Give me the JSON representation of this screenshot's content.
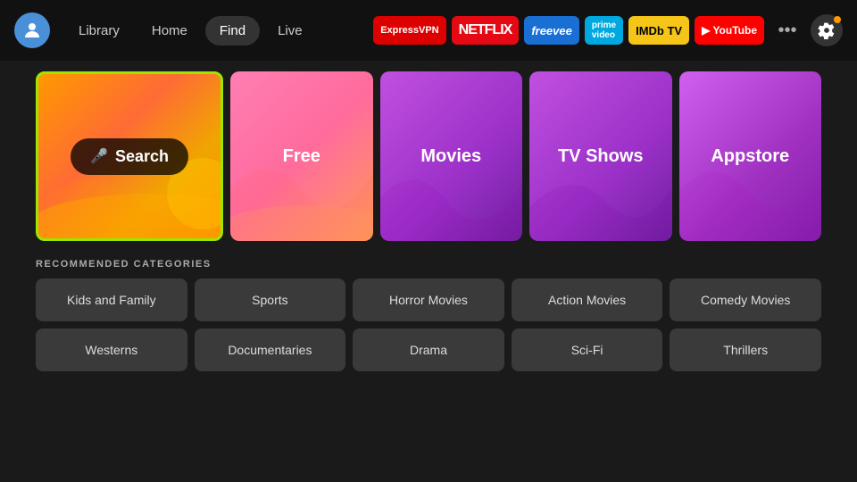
{
  "nav": {
    "links": [
      {
        "label": "Library",
        "active": false
      },
      {
        "label": "Home",
        "active": false
      },
      {
        "label": "Find",
        "active": true
      },
      {
        "label": "Live",
        "active": false
      }
    ]
  },
  "apps": [
    {
      "label": "ExpressVPN",
      "class": "badge-expressvpn"
    },
    {
      "label": "NETFLIX",
      "class": "badge-netflix"
    },
    {
      "label": "freevee",
      "class": "badge-freevee"
    },
    {
      "label": "prime video",
      "class": "badge-prime"
    },
    {
      "label": "IMDb TV",
      "class": "badge-imdb"
    },
    {
      "label": "▶ YouTube",
      "class": "badge-youtube"
    }
  ],
  "hero_tiles": [
    {
      "label": "Search",
      "type": "search"
    },
    {
      "label": "Free",
      "type": "free"
    },
    {
      "label": "Movies",
      "type": "movies"
    },
    {
      "label": "TV Shows",
      "type": "tvshows"
    },
    {
      "label": "Appstore",
      "type": "appstore"
    }
  ],
  "section_label": "RECOMMENDED CATEGORIES",
  "categories_row1": [
    {
      "label": "Kids and Family"
    },
    {
      "label": "Sports"
    },
    {
      "label": "Horror Movies"
    },
    {
      "label": "Action Movies"
    },
    {
      "label": "Comedy Movies"
    }
  ],
  "categories_row2": [
    {
      "label": "Westerns"
    },
    {
      "label": "Documentaries"
    },
    {
      "label": "Drama"
    },
    {
      "label": "Sci-Fi"
    },
    {
      "label": "Thrillers"
    }
  ]
}
